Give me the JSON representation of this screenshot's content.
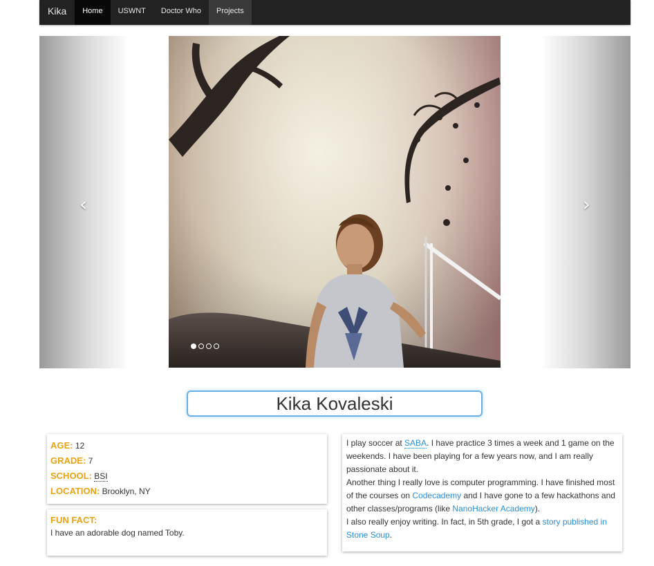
{
  "navbar": {
    "brand": "Kika",
    "items": [
      {
        "label": "Home"
      },
      {
        "label": "USWNT"
      },
      {
        "label": "Doctor Who"
      },
      {
        "label": "Projects"
      }
    ]
  },
  "carousel": {
    "prev_icon": "chevron-left-icon",
    "next_icon": "chevron-right-icon",
    "prev_glyph": "‹",
    "next_glyph": "›",
    "slide_count": 4,
    "active_slide": 1
  },
  "profile": {
    "name": "Kika Kovaleski",
    "age_label": "AGE:",
    "age": "12",
    "grade_label": "GRADE:",
    "grade": "7",
    "school_label": "SCHOOL:",
    "school": "BSI",
    "location_label": "LOCATION:",
    "location": "Brooklyn, NY",
    "fun_fact_label": "FUN FACT:",
    "fun_fact": "I have an adorable dog named Toby."
  },
  "about": {
    "p1_a": "I play soccer at ",
    "p1_link": "SABA",
    "p1_b": ". I have practice 3 times a week and 1 game on the weekends. I have been playing for a few years now, and I am really passionate about it.",
    "p2_a": "Another thing I really love is computer programming. I have finished most of the courses on ",
    "p2_link1": "Codecademy",
    "p2_b": " and I have gone to a few hackathons and other classes/programs (like ",
    "p2_link2": "NanoHacker Academy",
    "p2_c": ").",
    "p3_a": "I also really enjoy writing. In fact, in 5th grade, I got a ",
    "p3_link": "story published in Stone Soup",
    "p3_b": "."
  },
  "colors": {
    "label": "#e8a317",
    "link": "#2a8fd6",
    "focus": "#66afe9",
    "navbar": "#222222"
  }
}
